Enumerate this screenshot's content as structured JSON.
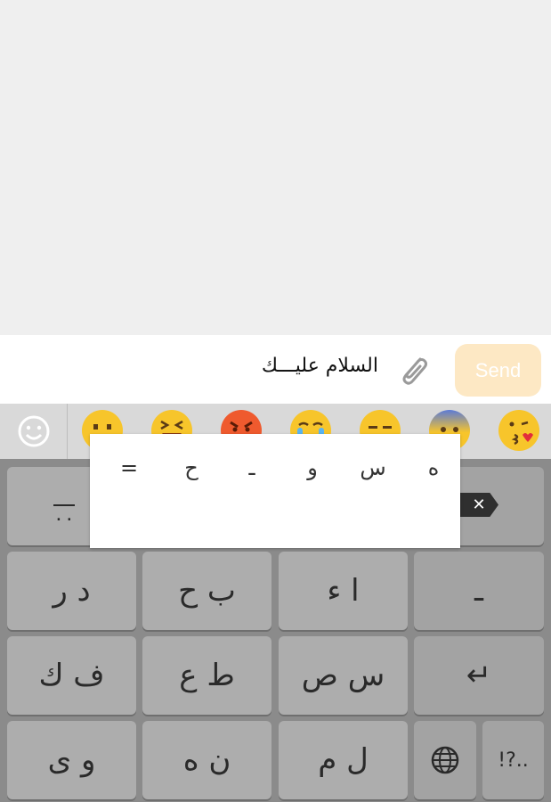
{
  "compose": {
    "message_text": "السلام عليـــك",
    "send_label": "Send"
  },
  "icons": {
    "attach": "paperclip-icon",
    "emoji_toggle": "smiley-icon",
    "globe": "globe-icon",
    "enter": "enter-icon",
    "delete": "backspace-icon"
  },
  "emoji_row": [
    "😐",
    "😆",
    "😠",
    "😢",
    "😑",
    "😨",
    "😘"
  ],
  "popup_options": [
    "ه",
    "س",
    "و",
    "ـ",
    "ح",
    "="
  ],
  "keyboard": {
    "row1_left_label": "٠٠",
    "row2": [
      "د ر",
      "ب ح",
      "ا ء",
      "ـ"
    ],
    "row3": [
      "ف ك",
      "ط ع",
      "س ص",
      "↵"
    ],
    "row4": [
      "و ى",
      "ن ه",
      "ل م",
      "",
      "!?.."
    ]
  },
  "colors": {
    "send_bg": "#fde8c4",
    "chat_bg": "#efefef",
    "key_bg": "#adadad"
  }
}
